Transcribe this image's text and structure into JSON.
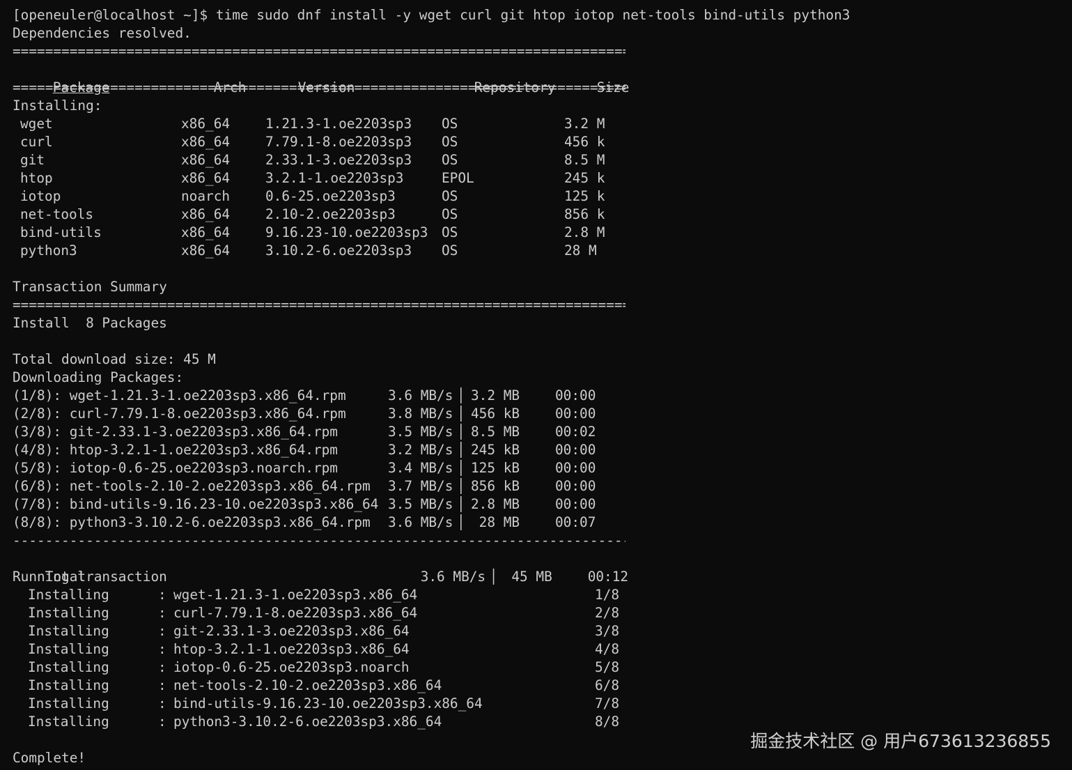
{
  "prompt_line": "[openeuler@localhost ~]$ time sudo dnf install -y wget curl git htop iotop net-tools bind-utils python3",
  "deps_resolved": "Dependencies resolved.",
  "separator_double": "================================================================================",
  "separator_dash": "--------------------------------------------------------------------------------",
  "table_header": {
    "package": "Package",
    "arch": "Arch",
    "version": "Version",
    "repository": "Repository",
    "size": "Size"
  },
  "installing_label": "Installing:",
  "packages": [
    {
      "name": "wget",
      "arch": "x86_64",
      "version": "1.21.3-1.oe2203sp3",
      "repo": "OS",
      "size": "3.2 M"
    },
    {
      "name": "curl",
      "arch": "x86_64",
      "version": "7.79.1-8.oe2203sp3",
      "repo": "OS",
      "size": "456 k"
    },
    {
      "name": "git",
      "arch": "x86_64",
      "version": "2.33.1-3.oe2203sp3",
      "repo": "OS",
      "size": "8.5 M"
    },
    {
      "name": "htop",
      "arch": "x86_64",
      "version": "3.2.1-1.oe2203sp3",
      "repo": "EPOL",
      "size": "245 k"
    },
    {
      "name": "iotop",
      "arch": "noarch",
      "version": "0.6-25.oe2203sp3",
      "repo": "OS",
      "size": "125 k"
    },
    {
      "name": "net-tools",
      "arch": "x86_64",
      "version": "2.10-2.oe2203sp3",
      "repo": "OS",
      "size": "856 k"
    },
    {
      "name": "bind-utils",
      "arch": "x86_64",
      "version": "9.16.23-10.oe2203sp3",
      "repo": "OS",
      "size": "2.8 M"
    },
    {
      "name": "python3",
      "arch": "x86_64",
      "version": "3.10.2-6.oe2203sp3",
      "repo": "OS",
      "size": "28 M"
    }
  ],
  "transaction_summary": "Transaction Summary",
  "install_summary": "Install  8 Packages",
  "total_download": "Total download size: 45 M",
  "downloading_label": "Downloading Packages:",
  "downloads": [
    {
      "file": "(1/8): wget-1.21.3-1.oe2203sp3.x86_64.rpm",
      "speed": "3.6 MB/s",
      "size": "3.2 MB",
      "time": "00:00"
    },
    {
      "file": "(2/8): curl-7.79.1-8.oe2203sp3.x86_64.rpm",
      "speed": "3.8 MB/s",
      "size": "456 kB",
      "time": "00:00"
    },
    {
      "file": "(3/8): git-2.33.1-3.oe2203sp3.x86_64.rpm",
      "speed": "3.5 MB/s",
      "size": "8.5 MB",
      "time": "00:02"
    },
    {
      "file": "(4/8): htop-3.2.1-1.oe2203sp3.x86_64.rpm",
      "speed": "3.2 MB/s",
      "size": "245 kB",
      "time": "00:00"
    },
    {
      "file": "(5/8): iotop-0.6-25.oe2203sp3.noarch.rpm",
      "speed": "3.4 MB/s",
      "size": "125 kB",
      "time": "00:00"
    },
    {
      "file": "(6/8): net-tools-2.10-2.oe2203sp3.x86_64.rpm",
      "speed": "3.7 MB/s",
      "size": "856 kB",
      "time": "00:00"
    },
    {
      "file": "(7/8): bind-utils-9.16.23-10.oe2203sp3.x86_64",
      "speed": "3.5 MB/s",
      "size": "2.8 MB",
      "time": "00:00"
    },
    {
      "file": "(8/8): python3-3.10.2-6.oe2203sp3.x86_64.rpm",
      "speed": "3.6 MB/s",
      "size": " 28 MB",
      "time": "00:07"
    }
  ],
  "total_row": {
    "label": "Total",
    "speed": "3.6 MB/s",
    "size": " 45 MB",
    "time": "00:12"
  },
  "running_transaction": "Running transaction",
  "install_steps": [
    {
      "action": "Installing",
      "pkg": "wget-1.21.3-1.oe2203sp3.x86_64",
      "progress": "1/8"
    },
    {
      "action": "Installing",
      "pkg": "curl-7.79.1-8.oe2203sp3.x86_64",
      "progress": "2/8"
    },
    {
      "action": "Installing",
      "pkg": "git-2.33.1-3.oe2203sp3.x86_64",
      "progress": "3/8"
    },
    {
      "action": "Installing",
      "pkg": "htop-3.2.1-1.oe2203sp3.x86_64",
      "progress": "4/8"
    },
    {
      "action": "Installing",
      "pkg": "iotop-0.6-25.oe2203sp3.noarch",
      "progress": "5/8"
    },
    {
      "action": "Installing",
      "pkg": "net-tools-2.10-2.oe2203sp3.x86_64",
      "progress": "6/8"
    },
    {
      "action": "Installing",
      "pkg": "bind-utils-9.16.23-10.oe2203sp3.x86_64",
      "progress": "7/8"
    },
    {
      "action": "Installing",
      "pkg": "python3-3.10.2-6.oe2203sp3.x86_64",
      "progress": "8/8"
    }
  ],
  "complete": "Complete!",
  "watermark": "掘金技术社区 @ 用户673613236855",
  "colors": {
    "background": "#0c0c0c",
    "text": "#cccccc"
  }
}
